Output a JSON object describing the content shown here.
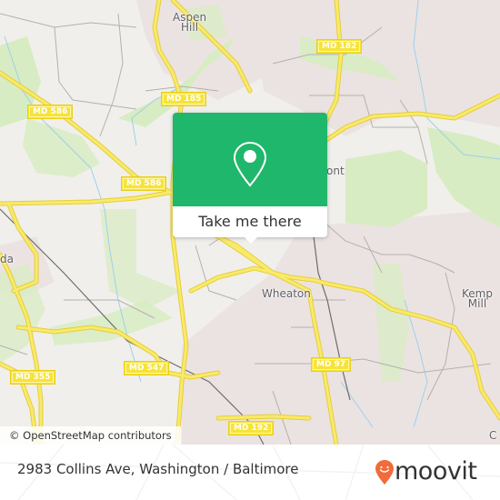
{
  "map": {
    "attribution": "© OpenStreetMap contributors",
    "colors": {
      "land": "#f1efeb",
      "residential": "#ebe3e1",
      "park": "#d7ecc2",
      "water": "#9dd0ec",
      "major_road": "#f6e33a",
      "minor_road": "#a6a2a0",
      "rail": "#6d6d6d"
    },
    "places": [
      {
        "name": "Aspen",
        "name2": "Hill"
      },
      {
        "name": "ont"
      },
      {
        "name": "da"
      },
      {
        "name": "Wheaton"
      },
      {
        "name": "Kemp",
        "name2": "Mill"
      },
      {
        "name": "C"
      }
    ],
    "shields": [
      {
        "label": "MD 182"
      },
      {
        "label": "MD 185"
      },
      {
        "label": "MD 586"
      },
      {
        "label": "MD 586"
      },
      {
        "label": "MD 355"
      },
      {
        "label": "MD 547"
      },
      {
        "label": "MD 97"
      },
      {
        "label": "MD 192"
      }
    ]
  },
  "popup": {
    "icon": "map-pin-icon",
    "button_label": "Take me there",
    "color": "#1fb76b"
  },
  "footer": {
    "address": "2983 Collins Ave, Washington / Baltimore",
    "brand": "moovit",
    "brand_icon": "moovit-pin-smiley-icon",
    "brand_color": "#f26b3a"
  }
}
